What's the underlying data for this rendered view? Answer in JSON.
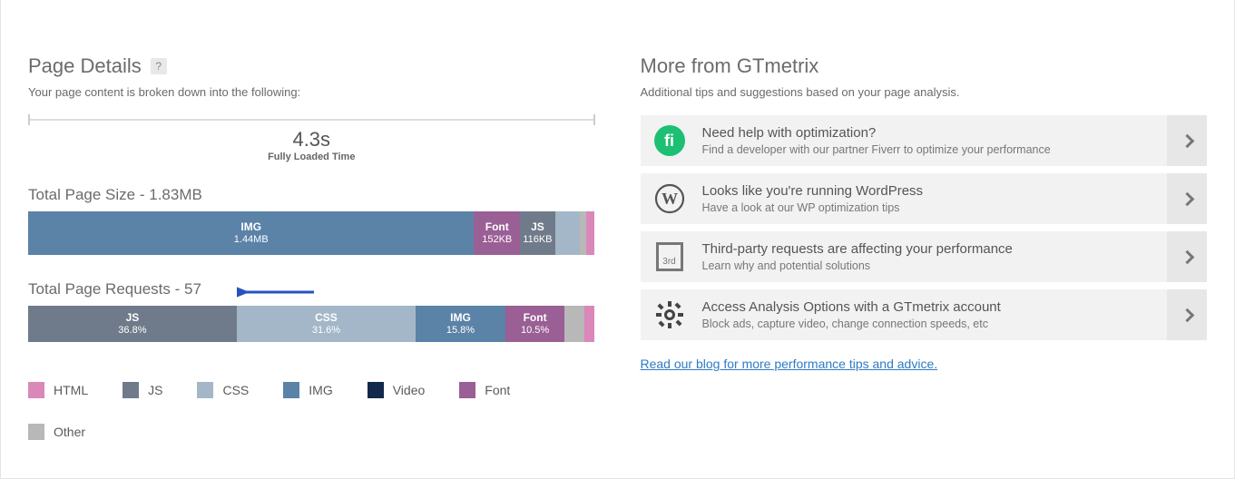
{
  "pageDetails": {
    "heading": "Page Details",
    "subtext": "Your page content is broken down into the following:",
    "timelineValue": "4.3s",
    "timelineLabel": "Fully Loaded Time",
    "totalSizeHeading": "Total Page Size - 1.83MB",
    "totalReqHeading": "Total Page Requests - 57"
  },
  "sizeSegments": [
    {
      "key": "img",
      "label": "IMG",
      "value": "1.44MB",
      "pct": 78.7,
      "color": "c-img"
    },
    {
      "key": "font",
      "label": "Font",
      "value": "152KB",
      "pct": 8.1,
      "color": "c-font"
    },
    {
      "key": "js",
      "label": "JS",
      "value": "116KB",
      "pct": 6.2,
      "color": "c-js"
    },
    {
      "key": "css",
      "label": "",
      "value": "",
      "pct": 4.3,
      "color": "c-css"
    },
    {
      "key": "other",
      "label": "",
      "value": "",
      "pct": 1.2,
      "color": "c-other"
    },
    {
      "key": "html",
      "label": "",
      "value": "",
      "pct": 1.5,
      "color": "c-html"
    }
  ],
  "reqSegments": [
    {
      "key": "js",
      "label": "JS",
      "value": "36.8%",
      "pct": 36.8,
      "color": "c-js"
    },
    {
      "key": "css",
      "label": "CSS",
      "value": "31.6%",
      "pct": 31.6,
      "color": "c-css"
    },
    {
      "key": "img",
      "label": "IMG",
      "value": "15.8%",
      "pct": 15.8,
      "color": "c-img"
    },
    {
      "key": "font",
      "label": "Font",
      "value": "10.5%",
      "pct": 10.5,
      "color": "c-font"
    },
    {
      "key": "other",
      "label": "",
      "value": "",
      "pct": 3.5,
      "color": "c-other"
    },
    {
      "key": "html",
      "label": "",
      "value": "",
      "pct": 1.8,
      "color": "c-html"
    }
  ],
  "legend": [
    {
      "label": "HTML",
      "color": "c-html"
    },
    {
      "label": "JS",
      "color": "c-js"
    },
    {
      "label": "CSS",
      "color": "c-css"
    },
    {
      "label": "IMG",
      "color": "c-img"
    },
    {
      "label": "Video",
      "color": "c-video"
    },
    {
      "label": "Font",
      "color": "c-font"
    },
    {
      "label": "Other",
      "color": "c-other"
    }
  ],
  "more": {
    "heading": "More from GTmetrix",
    "subtext": "Additional tips and suggestions based on your page analysis.",
    "blogLink": "Read our blog for more performance tips and advice."
  },
  "suggestions": [
    {
      "icon": "fiverr",
      "title": "Need help with optimization?",
      "desc": "Find a developer with our partner Fiverr to optimize your performance"
    },
    {
      "icon": "wordpress",
      "title": "Looks like you're running WordPress",
      "desc": "Have a look at our WP optimization tips"
    },
    {
      "icon": "third",
      "title": "Third-party requests are affecting your performance",
      "desc": "Learn why and potential solutions"
    },
    {
      "icon": "gear",
      "title": "Access Analysis Options with a GTmetrix account",
      "desc": "Block ads, capture video, change connection speeds, etc"
    }
  ],
  "chart_data": [
    {
      "type": "bar",
      "title": "Total Page Size - 1.83MB",
      "categories": [
        "IMG",
        "Font",
        "JS",
        "CSS",
        "Other",
        "HTML"
      ],
      "values_label": [
        "1.44MB",
        "152KB",
        "116KB",
        "",
        "",
        ""
      ],
      "values_pct_of_total": [
        78.7,
        8.1,
        6.2,
        4.3,
        1.2,
        1.5
      ],
      "total": "1.83MB"
    },
    {
      "type": "bar",
      "title": "Total Page Requests - 57",
      "categories": [
        "JS",
        "CSS",
        "IMG",
        "Font",
        "Other",
        "HTML"
      ],
      "values_pct": [
        36.8,
        31.6,
        15.8,
        10.5,
        3.5,
        1.8
      ],
      "total": 57
    }
  ]
}
